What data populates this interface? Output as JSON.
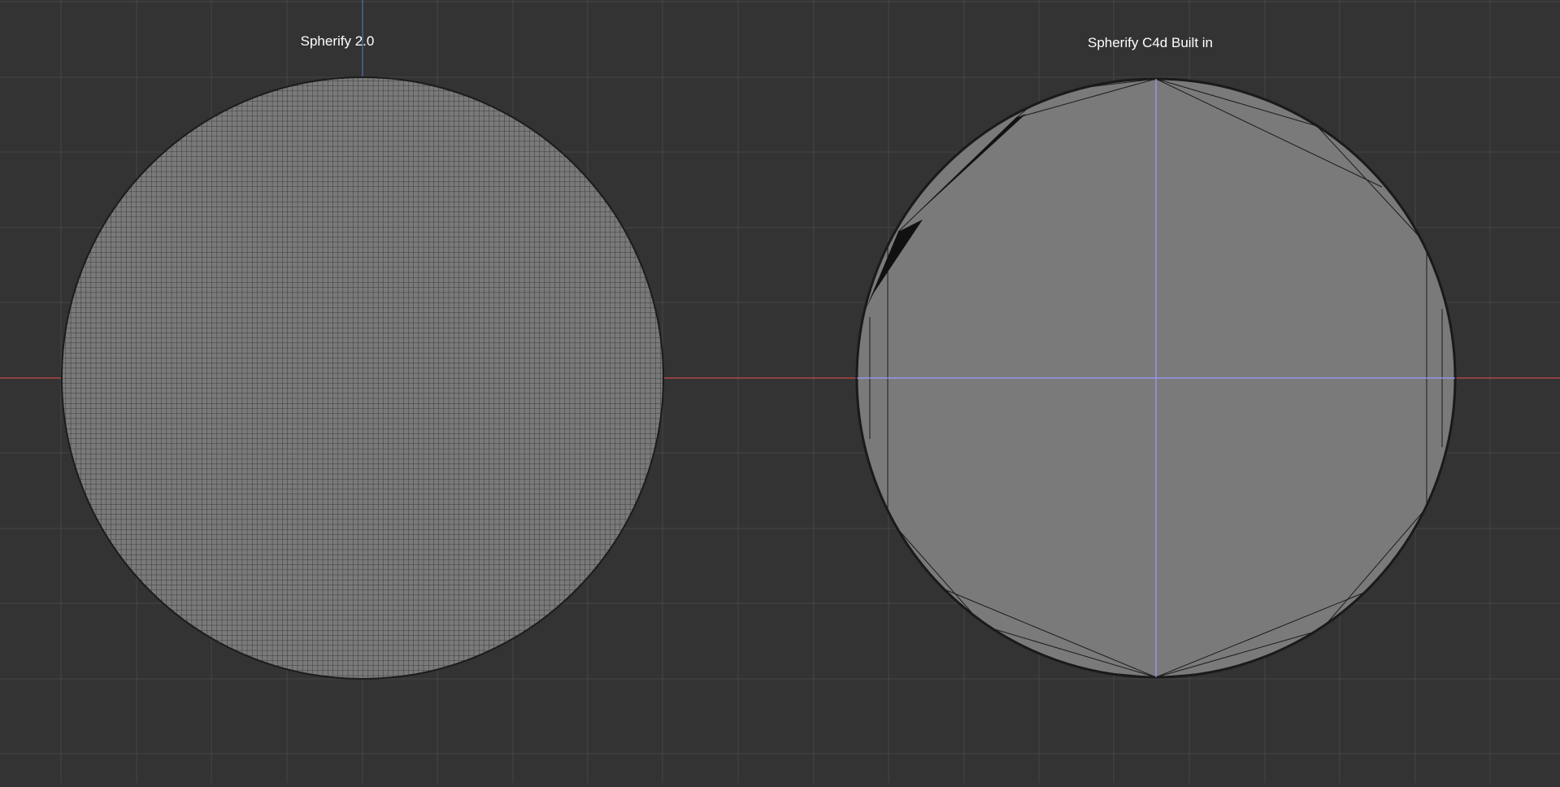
{
  "viewport": {
    "background_color": "#333333",
    "grid_color": "#464646",
    "x_axis_color": "#c84a4a",
    "y_axis_color": "#4f6fb8",
    "mesh_fill_color": "#7a7a7a",
    "mesh_line_color": "#3a3a3a",
    "edge_color": "#1c1c1c",
    "highlight_axis_color": "#9a9cff"
  },
  "objects": [
    {
      "label": "Spherify 2.0",
      "mesh": "dense-quad-grid"
    },
    {
      "label": "Spherify C4d Built in",
      "mesh": "sparse-triangulated"
    }
  ]
}
